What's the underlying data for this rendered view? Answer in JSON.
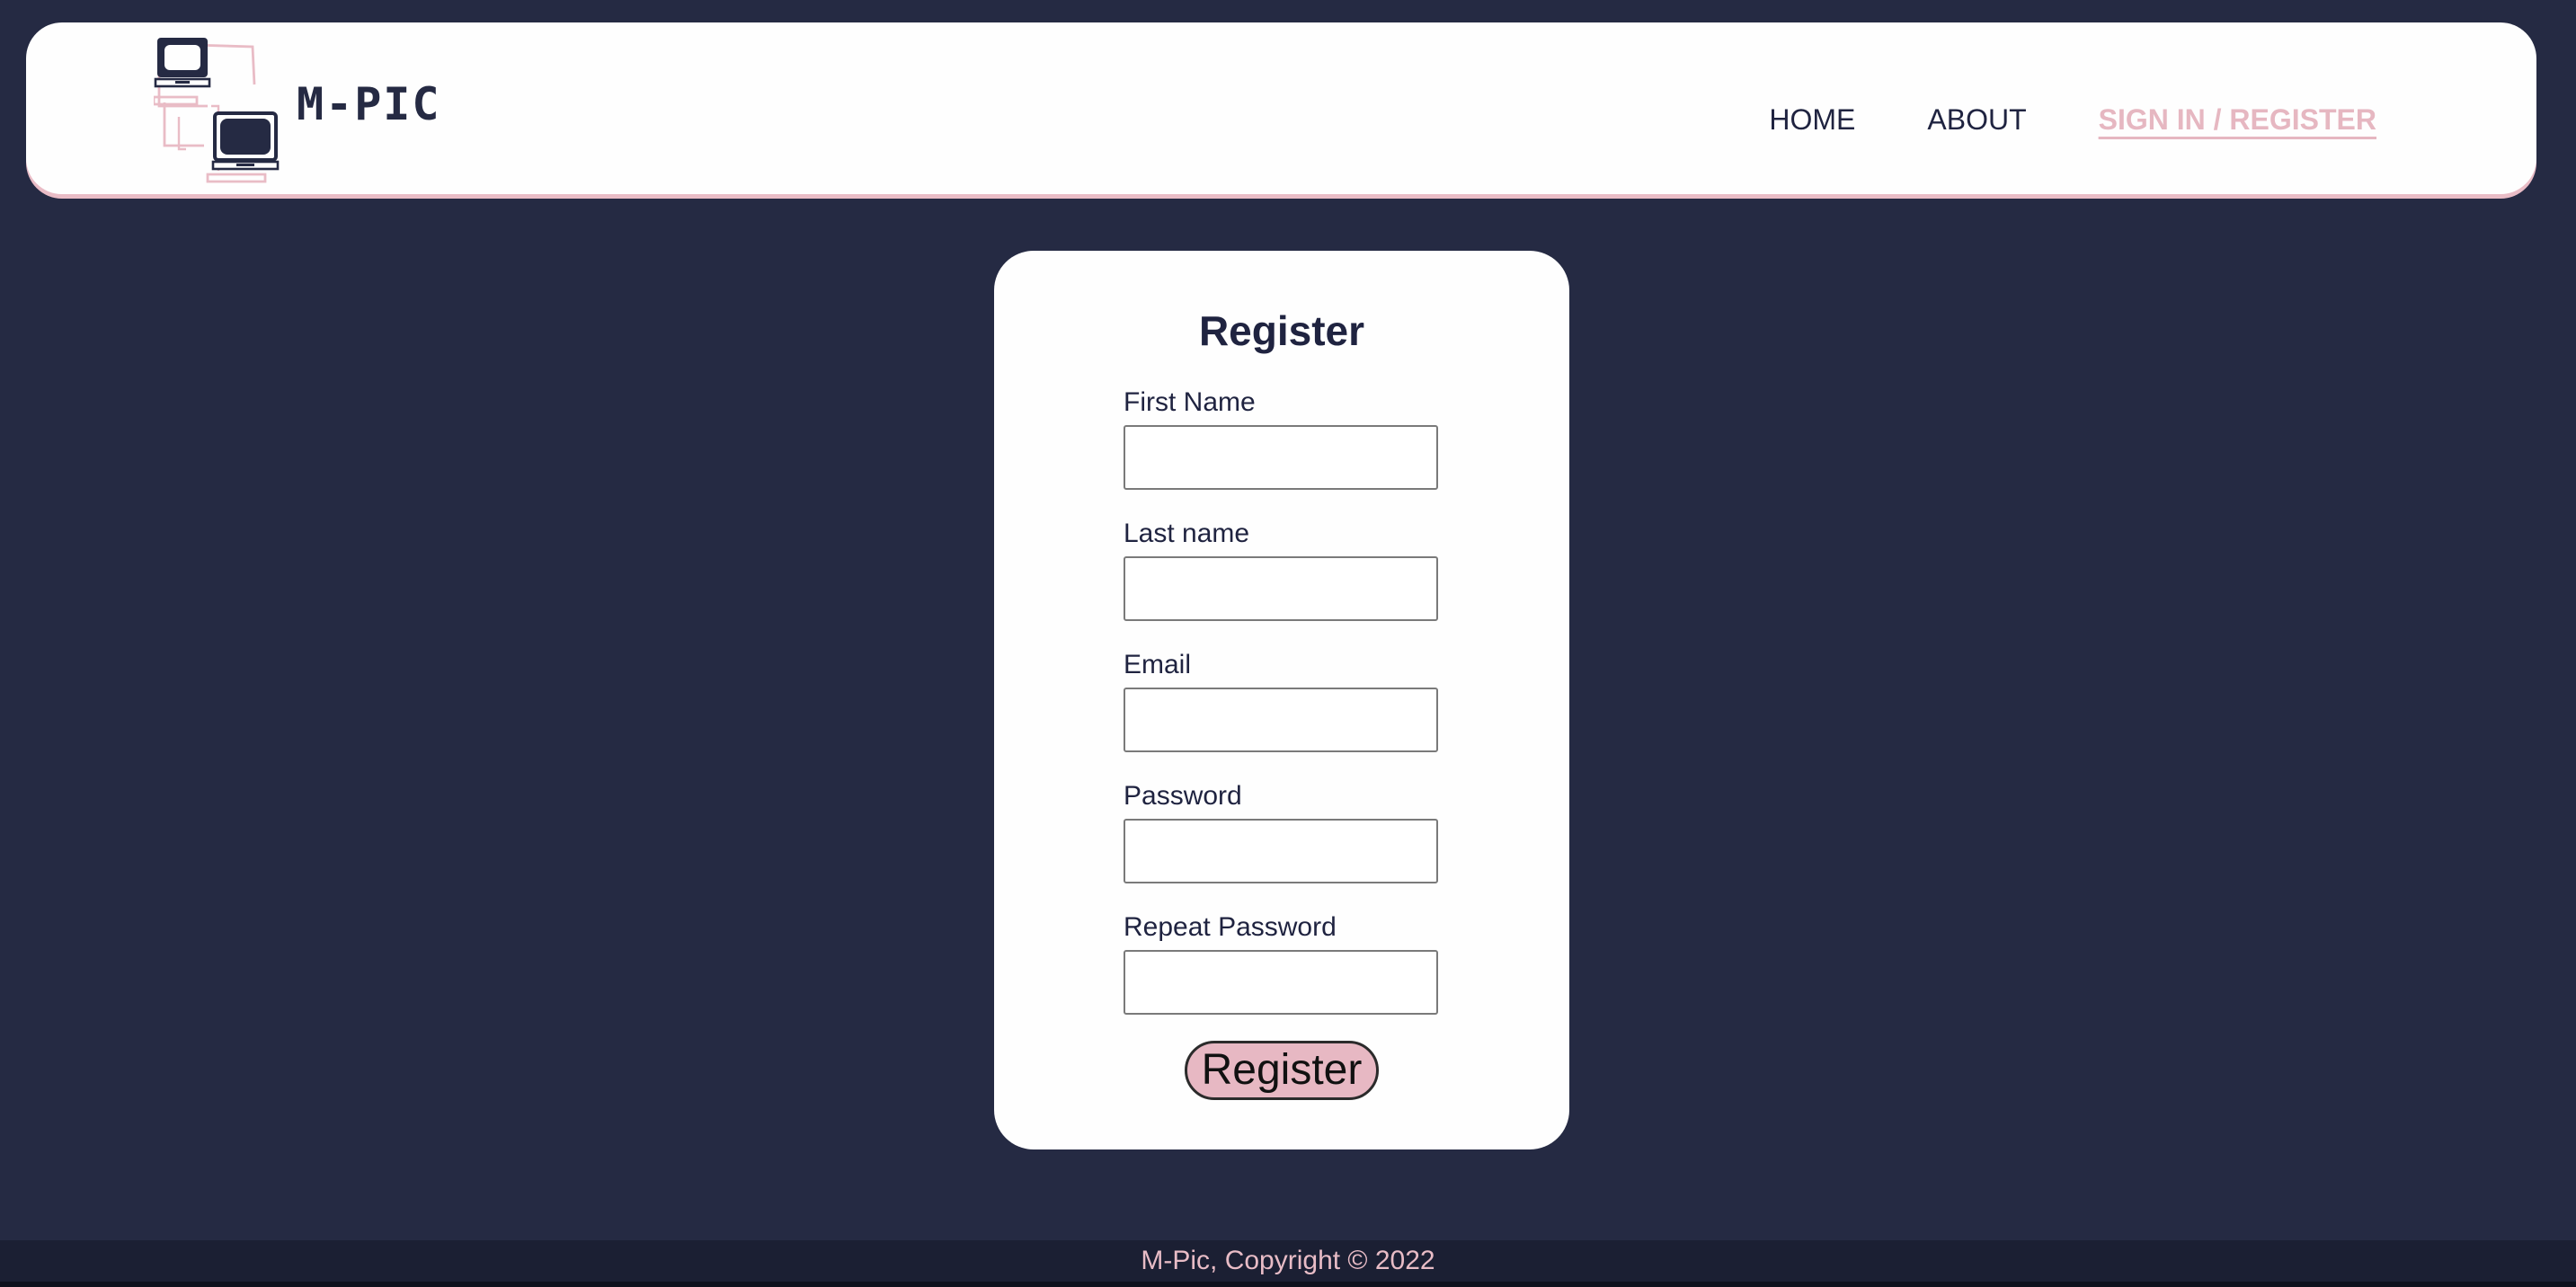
{
  "brand": {
    "name": "M-PIC",
    "logo_icon": "laptops-logo-icon"
  },
  "nav": {
    "items": [
      {
        "label": "HOME",
        "active": false
      },
      {
        "label": "ABOUT",
        "active": false
      },
      {
        "label": "SIGN IN / REGISTER",
        "active": true
      }
    ]
  },
  "form": {
    "title": "Register",
    "fields": [
      {
        "label": "First Name",
        "value": "",
        "placeholder": ""
      },
      {
        "label": "Last name",
        "value": "",
        "placeholder": ""
      },
      {
        "label": "Email",
        "value": "",
        "placeholder": ""
      },
      {
        "label": "Password",
        "value": "",
        "placeholder": ""
      },
      {
        "label": "Repeat Password",
        "value": "",
        "placeholder": ""
      }
    ],
    "submit_label": "Register"
  },
  "footer": {
    "text": "M-Pic, Copyright © 2022"
  },
  "colors": {
    "background": "#252a43",
    "accent": "#e7b8c3",
    "card": "#fefefe",
    "text_dark": "#1f2340",
    "footer": "#1b1f33"
  }
}
